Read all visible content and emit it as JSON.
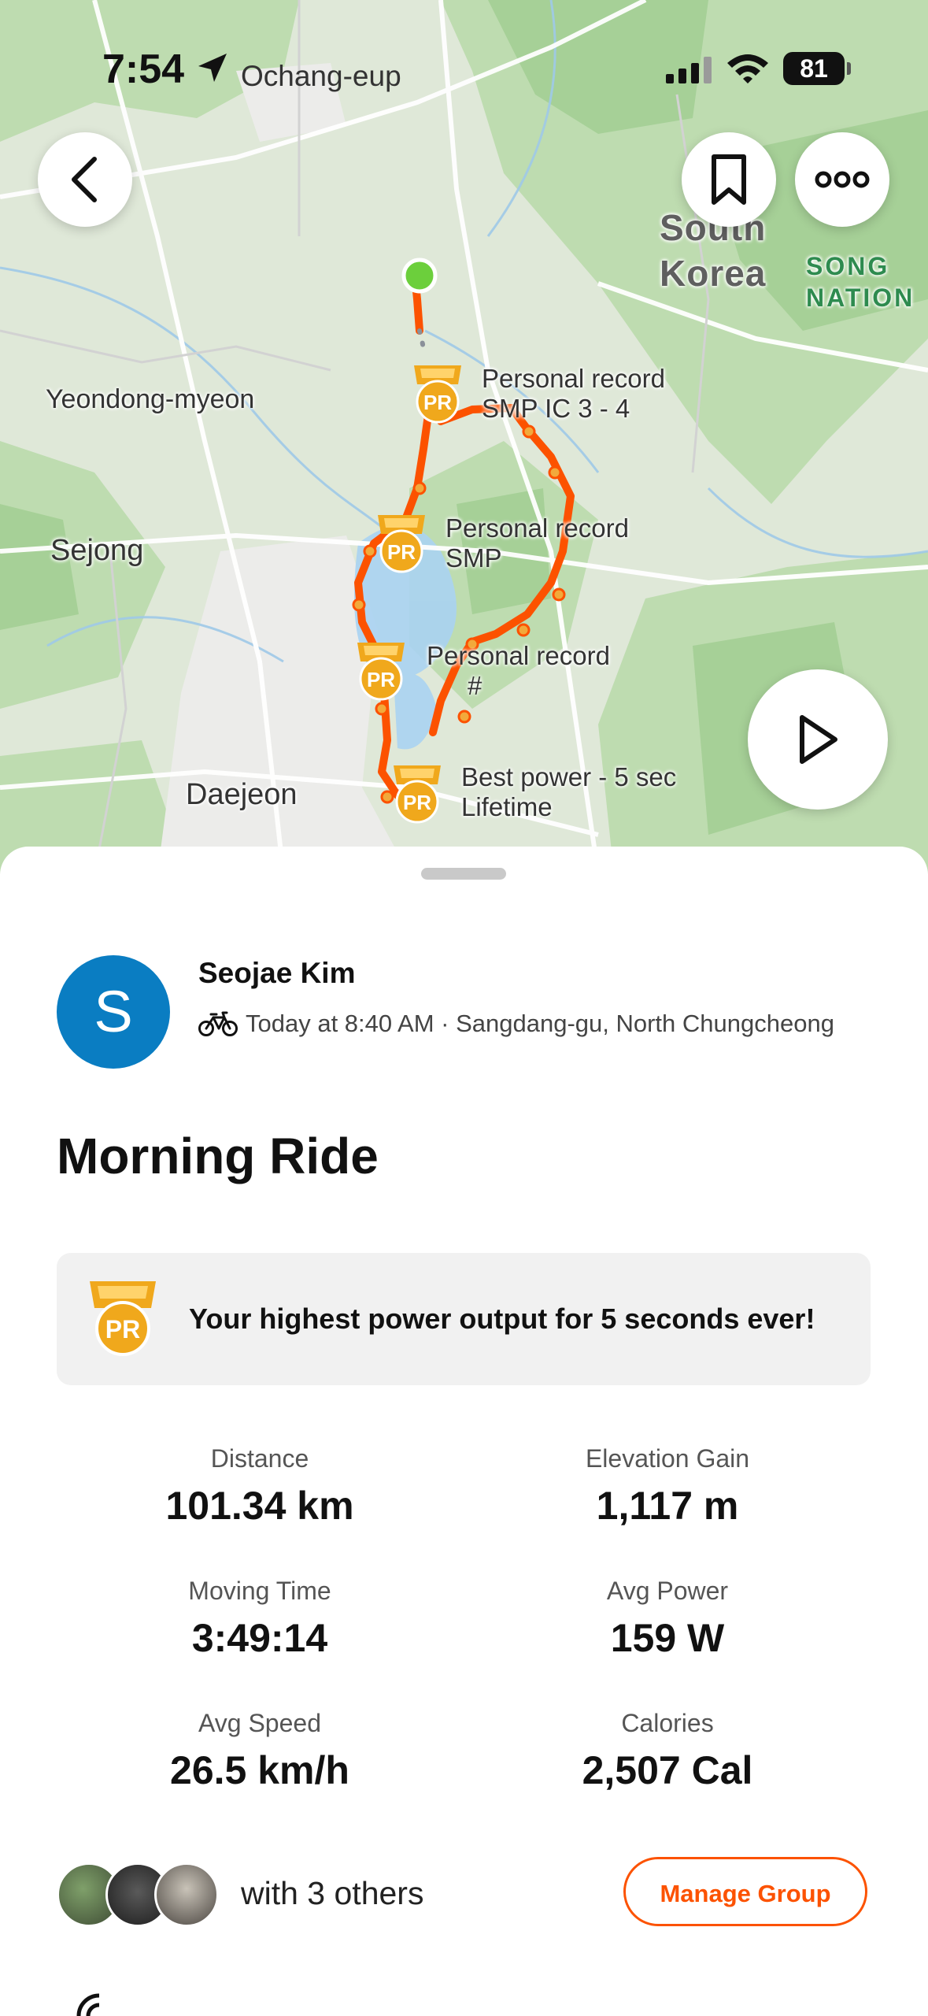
{
  "status_bar": {
    "time": "7:54",
    "location_name": "Ochang-eup",
    "battery": "81"
  },
  "map": {
    "labels": {
      "country": "South\nKorea",
      "nation_fragment": "SONG\nNATION",
      "yeondong": "Yeondong-myeon",
      "sejong": "Sejong",
      "daejeon": "Daejeon"
    },
    "pr_callouts": [
      {
        "line1": "Personal record",
        "line2": "SMP  IC 3  -  4"
      },
      {
        "line1": "Personal record",
        "line2": "SMP"
      },
      {
        "line1": "Personal record",
        "line2": "#"
      },
      {
        "line1": "Best power - 5 sec",
        "line2": "Lifetime"
      }
    ],
    "pr_badge_text": "PR",
    "route_color": "#fc5200",
    "start_color": "#6ccf3c",
    "medal_color": "#f0a81c"
  },
  "activity": {
    "athlete_initial": "S",
    "athlete_name": "Seojae Kim",
    "meta": "Today at 8:40 AM · Sangdang-gu, North Chungcheong",
    "title": "Morning Ride",
    "achievement": "Your highest power output for 5 seconds ever!",
    "stats": [
      {
        "label": "Distance",
        "value": "101.34 km"
      },
      {
        "label": "Elevation Gain",
        "value": "1,117 m"
      },
      {
        "label": "Moving Time",
        "value": "3:49:14"
      },
      {
        "label": "Avg Power",
        "value": "159 W"
      },
      {
        "label": "Avg Speed",
        "value": "26.5 km/h"
      },
      {
        "label": "Calories",
        "value": "2,507 Cal"
      }
    ],
    "group_text": "with 3 others",
    "manage_group_label": "Manage Group"
  },
  "colors": {
    "accent": "#fc5200",
    "avatar_bg": "#0a7dc2",
    "banner_bg": "#f1f1f1"
  }
}
